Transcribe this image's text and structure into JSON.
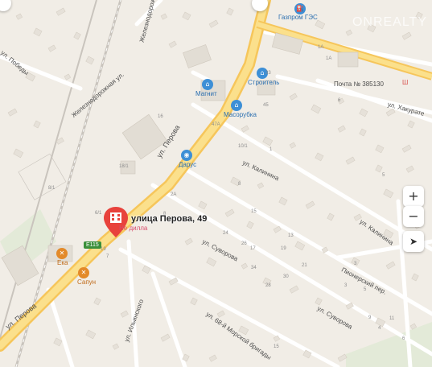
{
  "map": {
    "selected_address": "улица Перова, 49",
    "selected_sublabel": "Не дилла",
    "streets": {
      "perova_upper": "ул. Перова",
      "perova_lower": "ул. Перова",
      "zheleznodorozhnaya1": "Железнодорожная ул.",
      "zheleznodorozhnaya2": "Железнодорожная ул.",
      "pobedy": "ул. Победы",
      "kalinina1": "ул. Калинина",
      "kalinina2": "ул. Калинина",
      "suvorova1": "ул. Суворова",
      "suvorova2": "ул. Суворова",
      "hakurate": "ул. Хакурате",
      "pionerskiy": "Пионерский пер.",
      "brigady": "ул. 68-й Морской бригады",
      "ilyinskogo": "ул. Ильинского",
      "road_left": "ул. Победы"
    },
    "pois": {
      "magnit": "Магнит",
      "stroitel": "Строитель",
      "masorubka": "Масорубка",
      "darus": "Дарус",
      "gazprom": "Газпром ГЭС",
      "pochta": "Почта № 385130",
      "eka": "Ека",
      "sapun": "Сапун",
      "shi": "Ш"
    },
    "route_badge": "Е115",
    "watermark": "ONREALTY",
    "house_numbers": [
      "16",
      "18/1",
      "8/1",
      "8",
      "6/1",
      "47А",
      "45",
      "1А",
      "6",
      "19",
      "7",
      "10/1",
      "8",
      "1",
      "15",
      "17",
      "19",
      "21",
      "13",
      "22",
      "24",
      "26",
      "28",
      "30",
      "34",
      "3",
      "5",
      "9",
      "11",
      "15",
      "2А",
      "33",
      "1А",
      "6",
      "4",
      "3",
      "5"
    ]
  },
  "controls": {
    "zoom_in": "+",
    "zoom_out": "−",
    "locate": "➤"
  }
}
